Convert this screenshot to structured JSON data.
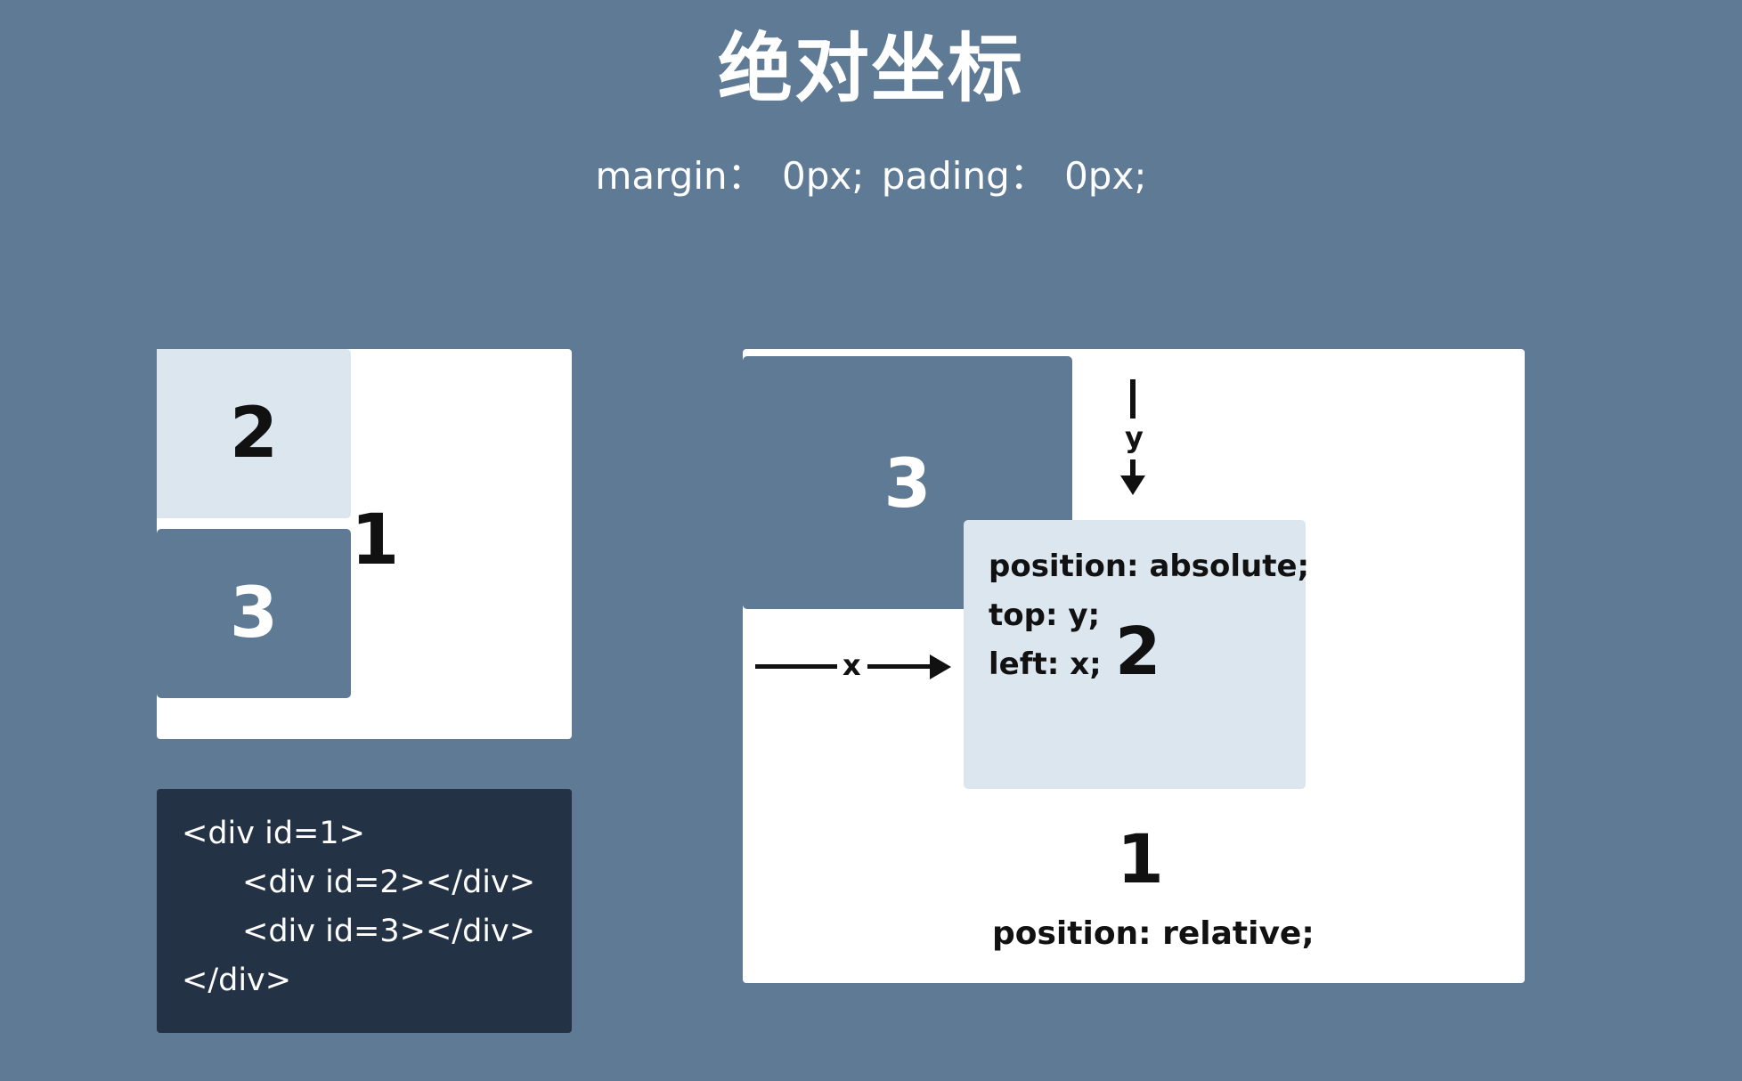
{
  "title": "绝对坐标",
  "subtitle": "margin：  0px;  pading：  0px;",
  "left_diagram": {
    "box2_label": "2",
    "box3_label": "3",
    "box1_label": "1"
  },
  "code": {
    "lines": [
      "<div id=1>",
      "<div id=2></div>",
      "<div id=3></div>",
      "</div>"
    ]
  },
  "right_diagram": {
    "box3_label": "3",
    "box2_label": "2",
    "box1_label": "1",
    "css_lines": [
      "position: absolute;",
      "top: y;",
      "left: x;"
    ],
    "y_label": "y",
    "x_label": "x",
    "parent_css": "position: relative;"
  },
  "colors": {
    "background": "#5f7a94",
    "light_box": "#dbe6ef",
    "dark_box": "#5f7a94",
    "code_bg": "#243245"
  }
}
